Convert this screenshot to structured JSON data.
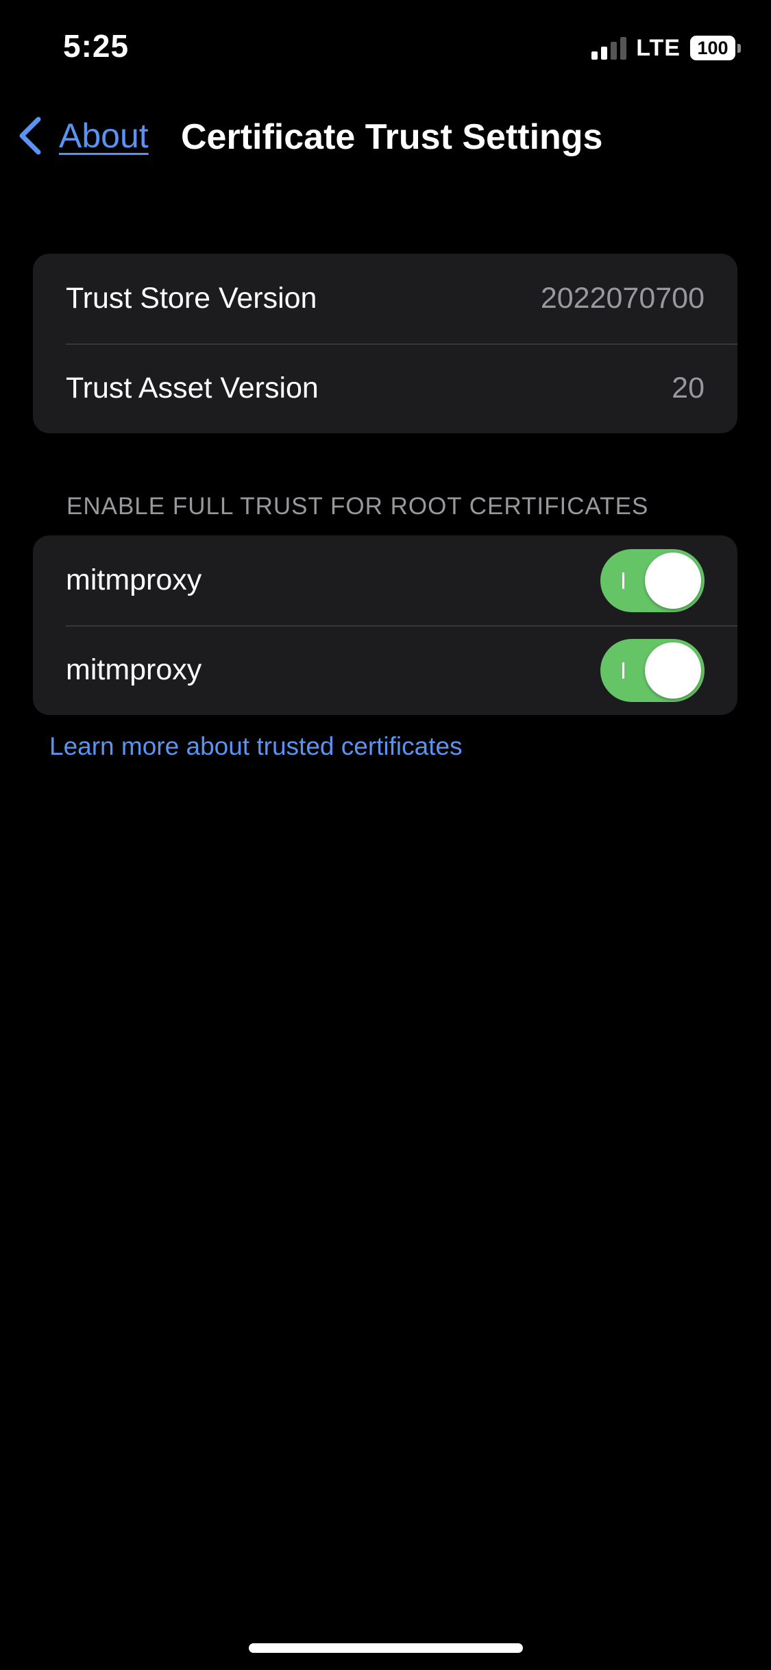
{
  "status_bar": {
    "time": "5:25",
    "network": "LTE",
    "battery": "100",
    "signal_bars_filled": 2,
    "signal_bars_total": 4,
    "icons": [
      "signal-icon",
      "battery-icon"
    ]
  },
  "nav": {
    "back_label": "About",
    "back_icon": "chevron-left-icon",
    "title": "Certificate Trust Settings"
  },
  "versions": {
    "rows": [
      {
        "label": "Trust Store Version",
        "value": "2022070700"
      },
      {
        "label": "Trust Asset Version",
        "value": "20"
      }
    ]
  },
  "certificates": {
    "header": "ENABLE FULL TRUST FOR ROOT CERTIFICATES",
    "rows": [
      {
        "label": "mitmproxy",
        "enabled": true
      },
      {
        "label": "mitmproxy",
        "enabled": true
      }
    ]
  },
  "footer": {
    "learn_more": "Learn more about trusted certificates"
  },
  "colors": {
    "background": "#000000",
    "cell_background": "#1c1c1e",
    "accent": "#5a93f0",
    "toggle_on": "#65c466",
    "secondary_text": "#98989d"
  }
}
